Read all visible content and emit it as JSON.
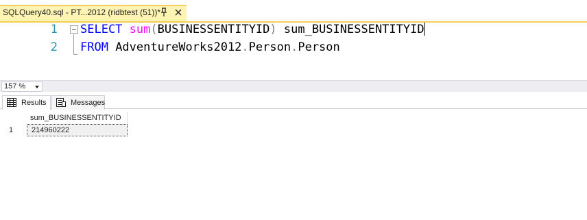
{
  "document_tab": {
    "title": "SQLQuery40.sql - PT...2012 (ridbtest (51))*",
    "pin_icon": "pin-icon",
    "close_icon": "close-icon"
  },
  "editor": {
    "lines": [
      {
        "number": "1",
        "tokens": {
          "kw1": "SELECT",
          "fn": "sum",
          "open": "(",
          "arg": "BUSINESSENTITYID",
          "close": ")",
          "alias": " sum_BUSINESSENTITYID"
        }
      },
      {
        "number": "2",
        "tokens": {
          "kw1": "FROM",
          "db": " AdventureWorks2012",
          "dot1": ".",
          "schema": "Person",
          "dot2": ".",
          "table": "Person"
        }
      }
    ],
    "colors": {
      "keyword": "#0000ff",
      "function": "#ff00ff",
      "operator": "#808080",
      "line_number": "#2b91af"
    }
  },
  "zoom": {
    "value": "157 %"
  },
  "results": {
    "tabs": [
      {
        "label": "Results",
        "icon": "grid-icon",
        "active": true
      },
      {
        "label": "Messages",
        "icon": "messages-icon",
        "active": false
      }
    ],
    "grid": {
      "columns": [
        "sum_BUSINESSENTITYID"
      ],
      "rows": [
        {
          "row_number": "1",
          "cells": [
            "214960222"
          ]
        }
      ]
    }
  }
}
